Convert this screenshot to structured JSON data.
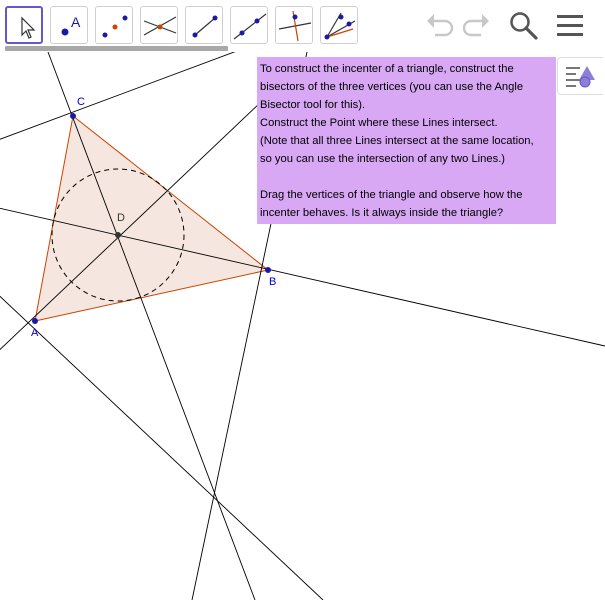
{
  "toolbar": {
    "tools": [
      {
        "id": "move",
        "name": "move-tool-button",
        "selected": true
      },
      {
        "id": "point",
        "name": "point-tool-button",
        "label": "A"
      },
      {
        "id": "point-on-object",
        "name": "point-on-object-tool-button"
      },
      {
        "id": "intersect",
        "name": "intersect-tool-button"
      },
      {
        "id": "segment",
        "name": "segment-tool-button"
      },
      {
        "id": "line",
        "name": "line-tool-button"
      },
      {
        "id": "perpendicular",
        "name": "perpendicular-line-tool-button"
      },
      {
        "id": "angle-bisector",
        "name": "angle-bisector-tool-button"
      }
    ],
    "right_icons": [
      "undo-icon",
      "redo-icon",
      "search-icon",
      "menu-icon"
    ]
  },
  "instructions": {
    "lines": [
      "To construct the incenter of a triangle, construct the",
      "bisectors of the three vertices (you can use the Angle",
      "Bisector tool for this).",
      "Construct the Point where these Lines intersect.",
      "(Note that all three Lines intersect at the same location,",
      "so you can use the intersection of any two Lines.)",
      "",
      "Drag the vertices of the triangle and observe how the",
      "incenter behaves. Is it always inside the triangle?"
    ],
    "background": "#d8a8f5"
  },
  "points": {
    "A": {
      "label": "A"
    },
    "B": {
      "label": "B"
    },
    "C": {
      "label": "C"
    },
    "D": {
      "label": "D"
    }
  },
  "colors": {
    "selected_tool": "#6557d2",
    "triangle_stroke": "#cc4400",
    "triangle_fill": "#f5e6e0",
    "point": "#1a1aa6",
    "line": "#000000"
  }
}
